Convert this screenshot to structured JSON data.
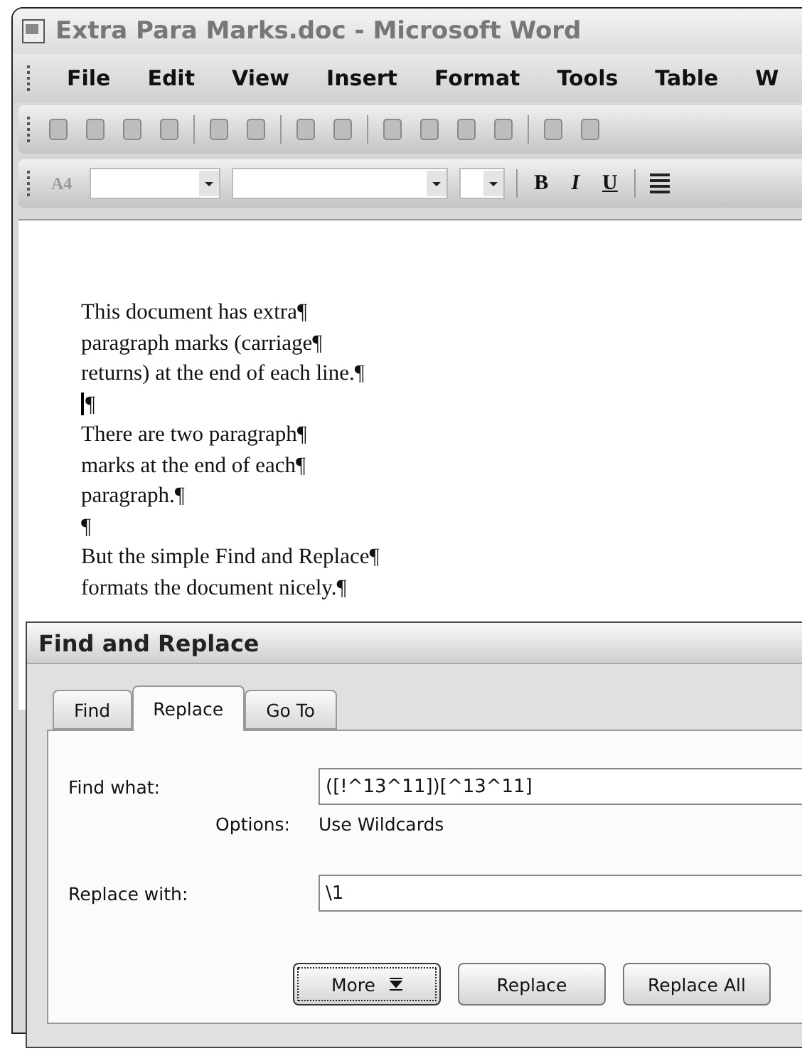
{
  "window": {
    "title": "Extra Para Marks.doc - Microsoft Word"
  },
  "menu": [
    {
      "label": "File"
    },
    {
      "label": "Edit"
    },
    {
      "label": "View"
    },
    {
      "label": "Insert"
    },
    {
      "label": "Format"
    },
    {
      "label": "Tools"
    },
    {
      "label": "Table"
    },
    {
      "label": "W"
    }
  ],
  "format_toolbar": {
    "style_glyph": "A4",
    "buttons": [
      "B",
      "I",
      "U"
    ]
  },
  "document": {
    "lines": [
      "This document has extra¶",
      "paragraph marks (carriage¶",
      "returns) at the end of each line.¶",
      "¶",
      "There are two paragraph¶",
      "marks at the end of each¶",
      "paragraph.¶",
      "¶",
      "But the simple Find and Replace¶",
      "formats the document nicely.¶"
    ]
  },
  "dialog": {
    "title": "Find and Replace",
    "tabs": [
      {
        "label": "Find",
        "selected": false
      },
      {
        "label": "Replace",
        "selected": true
      },
      {
        "label": "Go To",
        "selected": false
      }
    ],
    "find_label": "Find what:",
    "find_value": "([!^13^11])[^13^11]",
    "options_label": "Options:",
    "options_value": "Use Wildcards",
    "replace_label": "Replace with:",
    "replace_value": "\\1",
    "buttons": [
      {
        "label": "More",
        "kind": "expand",
        "focused": true
      },
      {
        "label": "Replace",
        "kind": "plain",
        "focused": false
      },
      {
        "label": "Replace All",
        "kind": "plain",
        "focused": false
      }
    ]
  }
}
